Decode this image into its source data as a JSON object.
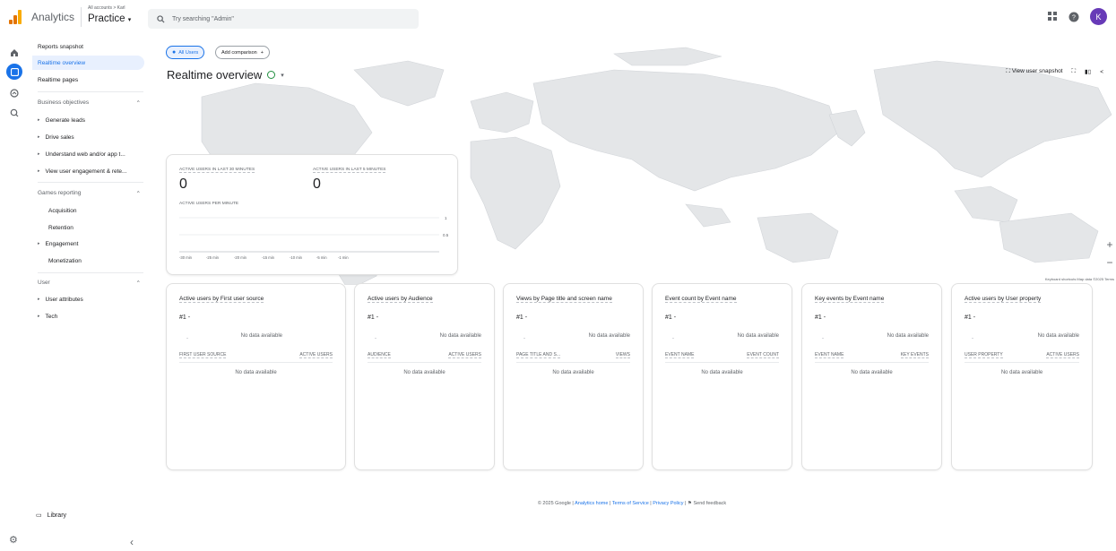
{
  "header": {
    "app_name": "Analytics",
    "account_small": "All accounts > Karl",
    "property_name": "Practice",
    "search_placeholder": "Try searching \"Admin\"",
    "avatar_letter": "K"
  },
  "sidenav": {
    "items": [
      {
        "label": "Reports snapshot"
      },
      {
        "label": "Realtime overview",
        "active": true
      },
      {
        "label": "Realtime pages"
      }
    ],
    "business_objectives": {
      "title": "Business objectives",
      "items": [
        "Generate leads",
        "Drive sales",
        "Understand web and/or app t...",
        "View user engagement & rete..."
      ]
    },
    "games_reporting": {
      "title": "Games reporting",
      "items": [
        "Acquisition",
        "Retention",
        "Engagement",
        "Monetization"
      ]
    },
    "user": {
      "title": "User",
      "items": [
        "User attributes",
        "Tech"
      ]
    },
    "library": "Library"
  },
  "main": {
    "chip_all_users": "All Users",
    "chip_add_comparison": "Add comparison",
    "title": "Realtime overview",
    "view_snapshot": "View user snapshot",
    "map_footer": "Keyboard shortcuts   Map data ©2025   Terms"
  },
  "realtime_card": {
    "label_30": "Active users in last 30 minutes",
    "value_30": "0",
    "label_5": "Active users in last 5 minutes",
    "value_5": "0",
    "label_per_min": "Active users per minute",
    "y_ticks": [
      "1",
      "0.5"
    ],
    "x_ticks": [
      "-30 min",
      "-25 min",
      "-20 min",
      "-15 min",
      "-10 min",
      "-5 min",
      "-1 min"
    ]
  },
  "cards": [
    {
      "title": "Active users by First user source",
      "rank": "#1  -",
      "nodata": "No data available",
      "col1": "First user source",
      "col2": "Active users"
    },
    {
      "title": "Active users by Audience",
      "rank": "#1  -",
      "nodata": "No data available",
      "col1": "Audience",
      "col2": "Active users"
    },
    {
      "title": "Views by Page title and screen name",
      "rank": "#1  -",
      "nodata": "No data available",
      "col1": "Page title and s...",
      "col2": "Views"
    },
    {
      "title": "Event count by Event name",
      "rank": "#1  -",
      "nodata": "No data available",
      "col1": "Event name",
      "col2": "Event count"
    },
    {
      "title": "Key events by Event name",
      "rank": "#1  -",
      "nodata": "No data available",
      "col1": "Event name",
      "col2": "Key events"
    },
    {
      "title": "Active users by User property",
      "rank": "#1  -",
      "nodata": "No data available",
      "col1": "User property",
      "col2": "Active users"
    }
  ],
  "footer": {
    "copyright": "© 2025 Google |",
    "analytics_home": "Analytics home",
    "terms": "Terms of Service",
    "privacy": "Privacy Policy",
    "feedback": "Send feedback"
  }
}
